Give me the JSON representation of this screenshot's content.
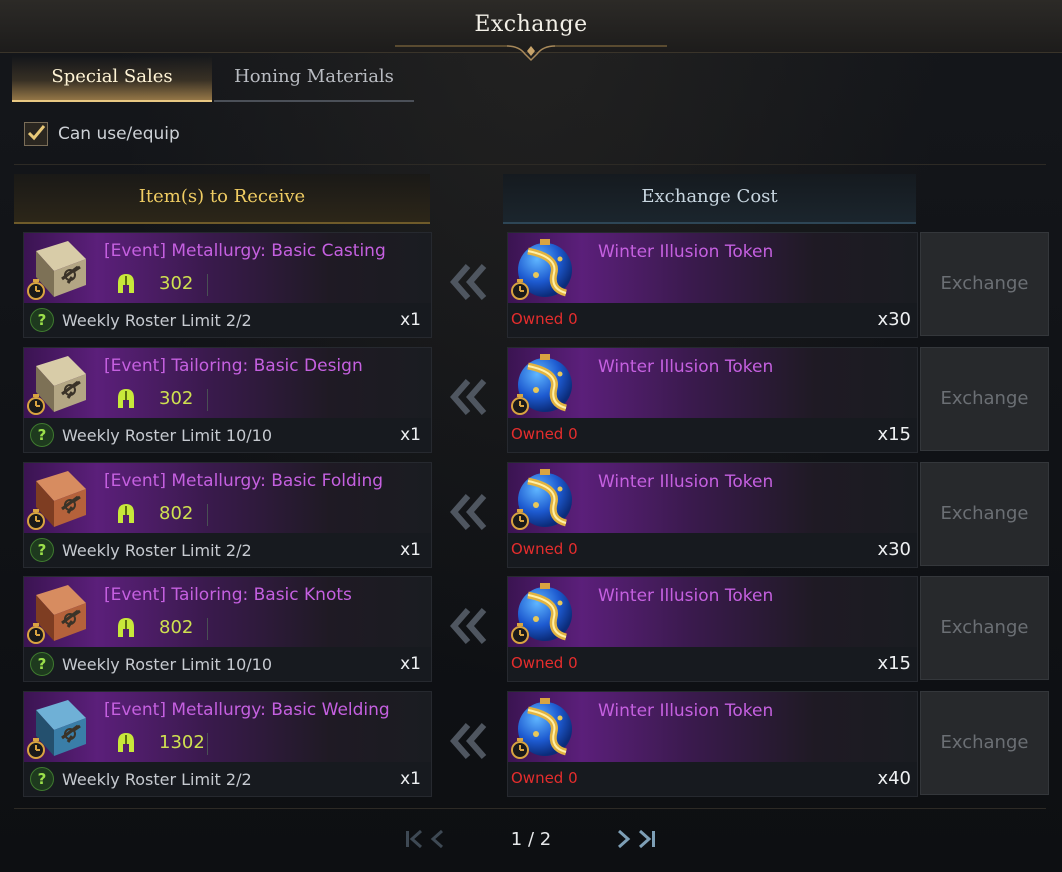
{
  "window": {
    "title": "Exchange"
  },
  "tabs": [
    {
      "label": "Special Sales",
      "active": true
    },
    {
      "label": "Honing Materials",
      "active": false
    }
  ],
  "filter": {
    "label": "Can use/equip",
    "checked": true
  },
  "headers": {
    "receive": "Item(s) to Receive",
    "cost": "Exchange Cost"
  },
  "rows": [
    {
      "item_name": "[Event] Metallurgy: Basic Casting",
      "item_level": "302",
      "limit": "Weekly Roster Limit 2/2",
      "item_qty": "x1",
      "book_color": "tan",
      "token_name": "Winter Illusion Token",
      "owned": "Owned 0",
      "cost_qty": "x30",
      "button": "Exchange"
    },
    {
      "item_name": "[Event] Tailoring: Basic Design",
      "item_level": "302",
      "limit": "Weekly Roster Limit 10/10",
      "item_qty": "x1",
      "book_color": "tan",
      "token_name": "Winter Illusion Token",
      "owned": "Owned 0",
      "cost_qty": "x15",
      "button": "Exchange"
    },
    {
      "item_name": "[Event] Metallurgy: Basic Folding",
      "item_level": "802",
      "limit": "Weekly Roster Limit 2/2",
      "item_qty": "x1",
      "book_color": "brown",
      "token_name": "Winter Illusion Token",
      "owned": "Owned 0",
      "cost_qty": "x30",
      "button": "Exchange"
    },
    {
      "item_name": "[Event] Tailoring: Basic Knots",
      "item_level": "802",
      "limit": "Weekly Roster Limit 10/10",
      "item_qty": "x1",
      "book_color": "brown",
      "token_name": "Winter Illusion Token",
      "owned": "Owned 0",
      "cost_qty": "x15",
      "button": "Exchange"
    },
    {
      "item_name": "[Event] Metallurgy: Basic Welding",
      "item_level": "1302",
      "limit": "Weekly Roster Limit 2/2",
      "item_qty": "x1",
      "book_color": "blue",
      "token_name": "Winter Illusion Token",
      "owned": "Owned 0",
      "cost_qty": "x40",
      "button": "Exchange"
    }
  ],
  "pagination": {
    "label": "1 / 2"
  },
  "colors": {
    "item_name": "#c560e0",
    "item_level": "#cfe050",
    "owned": "#e52d2d",
    "header_receive": "#f0cd63",
    "tab_active_underline": "#e8c883"
  },
  "icons": {
    "book": "recipe-book-icon",
    "timer": "timer-icon",
    "helmet": "helmet-icon",
    "help": "question-icon",
    "token": "winter-illusion-token-icon",
    "arrow": "double-chevron-left-icon"
  }
}
